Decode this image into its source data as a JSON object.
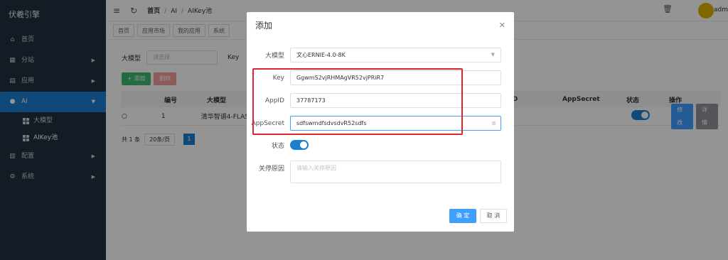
{
  "sidebar": {
    "brand": "伏羲引擎",
    "items": [
      {
        "label": "首页",
        "icon": "home-icon",
        "glyph": "⌂"
      },
      {
        "label": "分站",
        "icon": "building-icon",
        "glyph": "▦"
      },
      {
        "label": "应用",
        "icon": "grid-icon",
        "glyph": "▤"
      },
      {
        "label": "AI",
        "icon": "bulb-icon",
        "glyph": "●"
      },
      {
        "label": "配置",
        "icon": "chart-icon",
        "glyph": "▥"
      },
      {
        "label": "系统",
        "icon": "gear-icon",
        "glyph": "⚙"
      }
    ],
    "sub_items": [
      {
        "label": "大模型"
      },
      {
        "label": "AIKey池"
      }
    ]
  },
  "topbar": {
    "breadcrumb": [
      "首页",
      "AI",
      "AIKey池"
    ],
    "user": "adm"
  },
  "tabs": [
    "首页",
    "应用市场",
    "我的应用",
    "系统"
  ],
  "filter": {
    "model_label": "大模型",
    "model_placeholder": "请选择",
    "key_label": "Key"
  },
  "toolbar": {
    "add": "+ 添加",
    "delete": "删除"
  },
  "table": {
    "headers": [
      "编号",
      "大模型",
      "pID",
      "AppSecret",
      "状态",
      "操作"
    ],
    "rows": [
      {
        "id": "1",
        "model": "清华智谱4-FLASH",
        "edit": "修改",
        "detail": "详情"
      }
    ]
  },
  "pager": {
    "total": "共 1 条",
    "size": "20条/页",
    "page": "1"
  },
  "modal": {
    "title": "添加",
    "fields": {
      "model": {
        "label": "大模型",
        "value": "文心ERNIE-4.0-8K"
      },
      "key": {
        "label": "Key",
        "value": "GgwmS2vjRHMAgVR52vjPRiR7"
      },
      "appid": {
        "label": "AppID",
        "value": "37787173"
      },
      "appsecret": {
        "label": "AppSecret",
        "value": "sdfswmdfsdvsdvR52sdfs"
      },
      "status": {
        "label": "状态",
        "on": true
      },
      "reason": {
        "label": "关停原因",
        "placeholder": "请输入关停原因"
      }
    },
    "confirm": "确 定",
    "cancel": "取 消"
  },
  "colors": {
    "primary": "#1b7fd0",
    "highlight": "#e0242b",
    "sidebar": "#22303f"
  }
}
